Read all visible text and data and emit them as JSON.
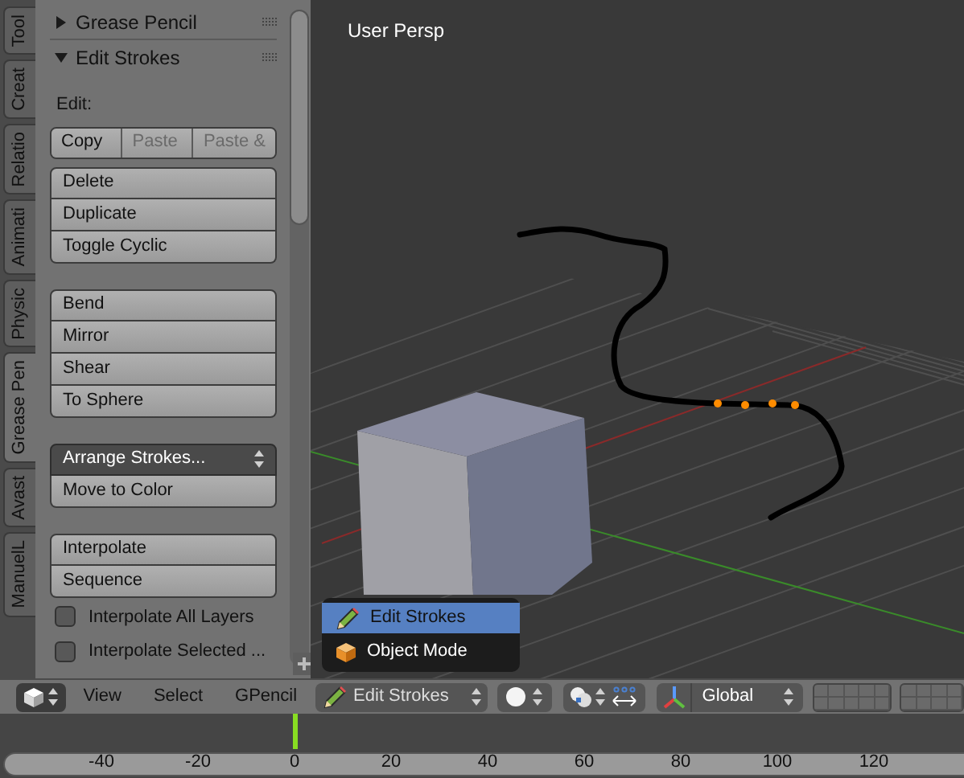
{
  "tabs": [
    {
      "label": "Tool",
      "selected": false
    },
    {
      "label": "Creat",
      "selected": false
    },
    {
      "label": "Relatio",
      "selected": false
    },
    {
      "label": "Animati",
      "selected": false
    },
    {
      "label": "Physic",
      "selected": false
    },
    {
      "label": "Grease Pen",
      "selected": true
    },
    {
      "label": "Avast",
      "selected": false
    },
    {
      "label": "ManuelL",
      "selected": false
    }
  ],
  "panels": [
    {
      "title": "Grease Pencil",
      "expanded": false
    },
    {
      "title": "Edit Strokes",
      "expanded": true
    }
  ],
  "edit_label": "Edit:",
  "clipboard": [
    {
      "label": "Copy",
      "disabled": false
    },
    {
      "label": "Paste",
      "disabled": true
    },
    {
      "label": "Paste &",
      "disabled": true
    }
  ],
  "groups": [
    [
      {
        "label": "Delete",
        "kind": "button"
      },
      {
        "label": "Duplicate",
        "kind": "button"
      },
      {
        "label": "Toggle Cyclic",
        "kind": "button"
      }
    ],
    [
      {
        "label": "Bend",
        "kind": "button"
      },
      {
        "label": "Mirror",
        "kind": "button"
      },
      {
        "label": "Shear",
        "kind": "button"
      },
      {
        "label": "To Sphere",
        "kind": "button"
      }
    ],
    [
      {
        "label": "Arrange Strokes...",
        "kind": "dropdown"
      },
      {
        "label": "Move to Color",
        "kind": "button"
      }
    ],
    [
      {
        "label": "Interpolate",
        "kind": "button"
      },
      {
        "label": "Sequence",
        "kind": "button"
      }
    ]
  ],
  "checkboxes": [
    {
      "label": "Interpolate All Layers",
      "checked": false
    },
    {
      "label": "Interpolate Selected ...",
      "checked": false
    }
  ],
  "viewport": {
    "label": "User Persp"
  },
  "mode_menu": [
    {
      "label": "Edit Strokes",
      "kind": "pencil",
      "selected": true
    },
    {
      "label": "Object Mode",
      "kind": "cube",
      "selected": false
    }
  ],
  "header": {
    "menus": [
      "View",
      "Select",
      "GPencil"
    ],
    "mode": "Edit Strokes",
    "orientation": "Global"
  },
  "timeline": {
    "ticks": [
      "-40",
      "-20",
      "0",
      "20",
      "40",
      "60",
      "80",
      "100",
      "120"
    ]
  }
}
